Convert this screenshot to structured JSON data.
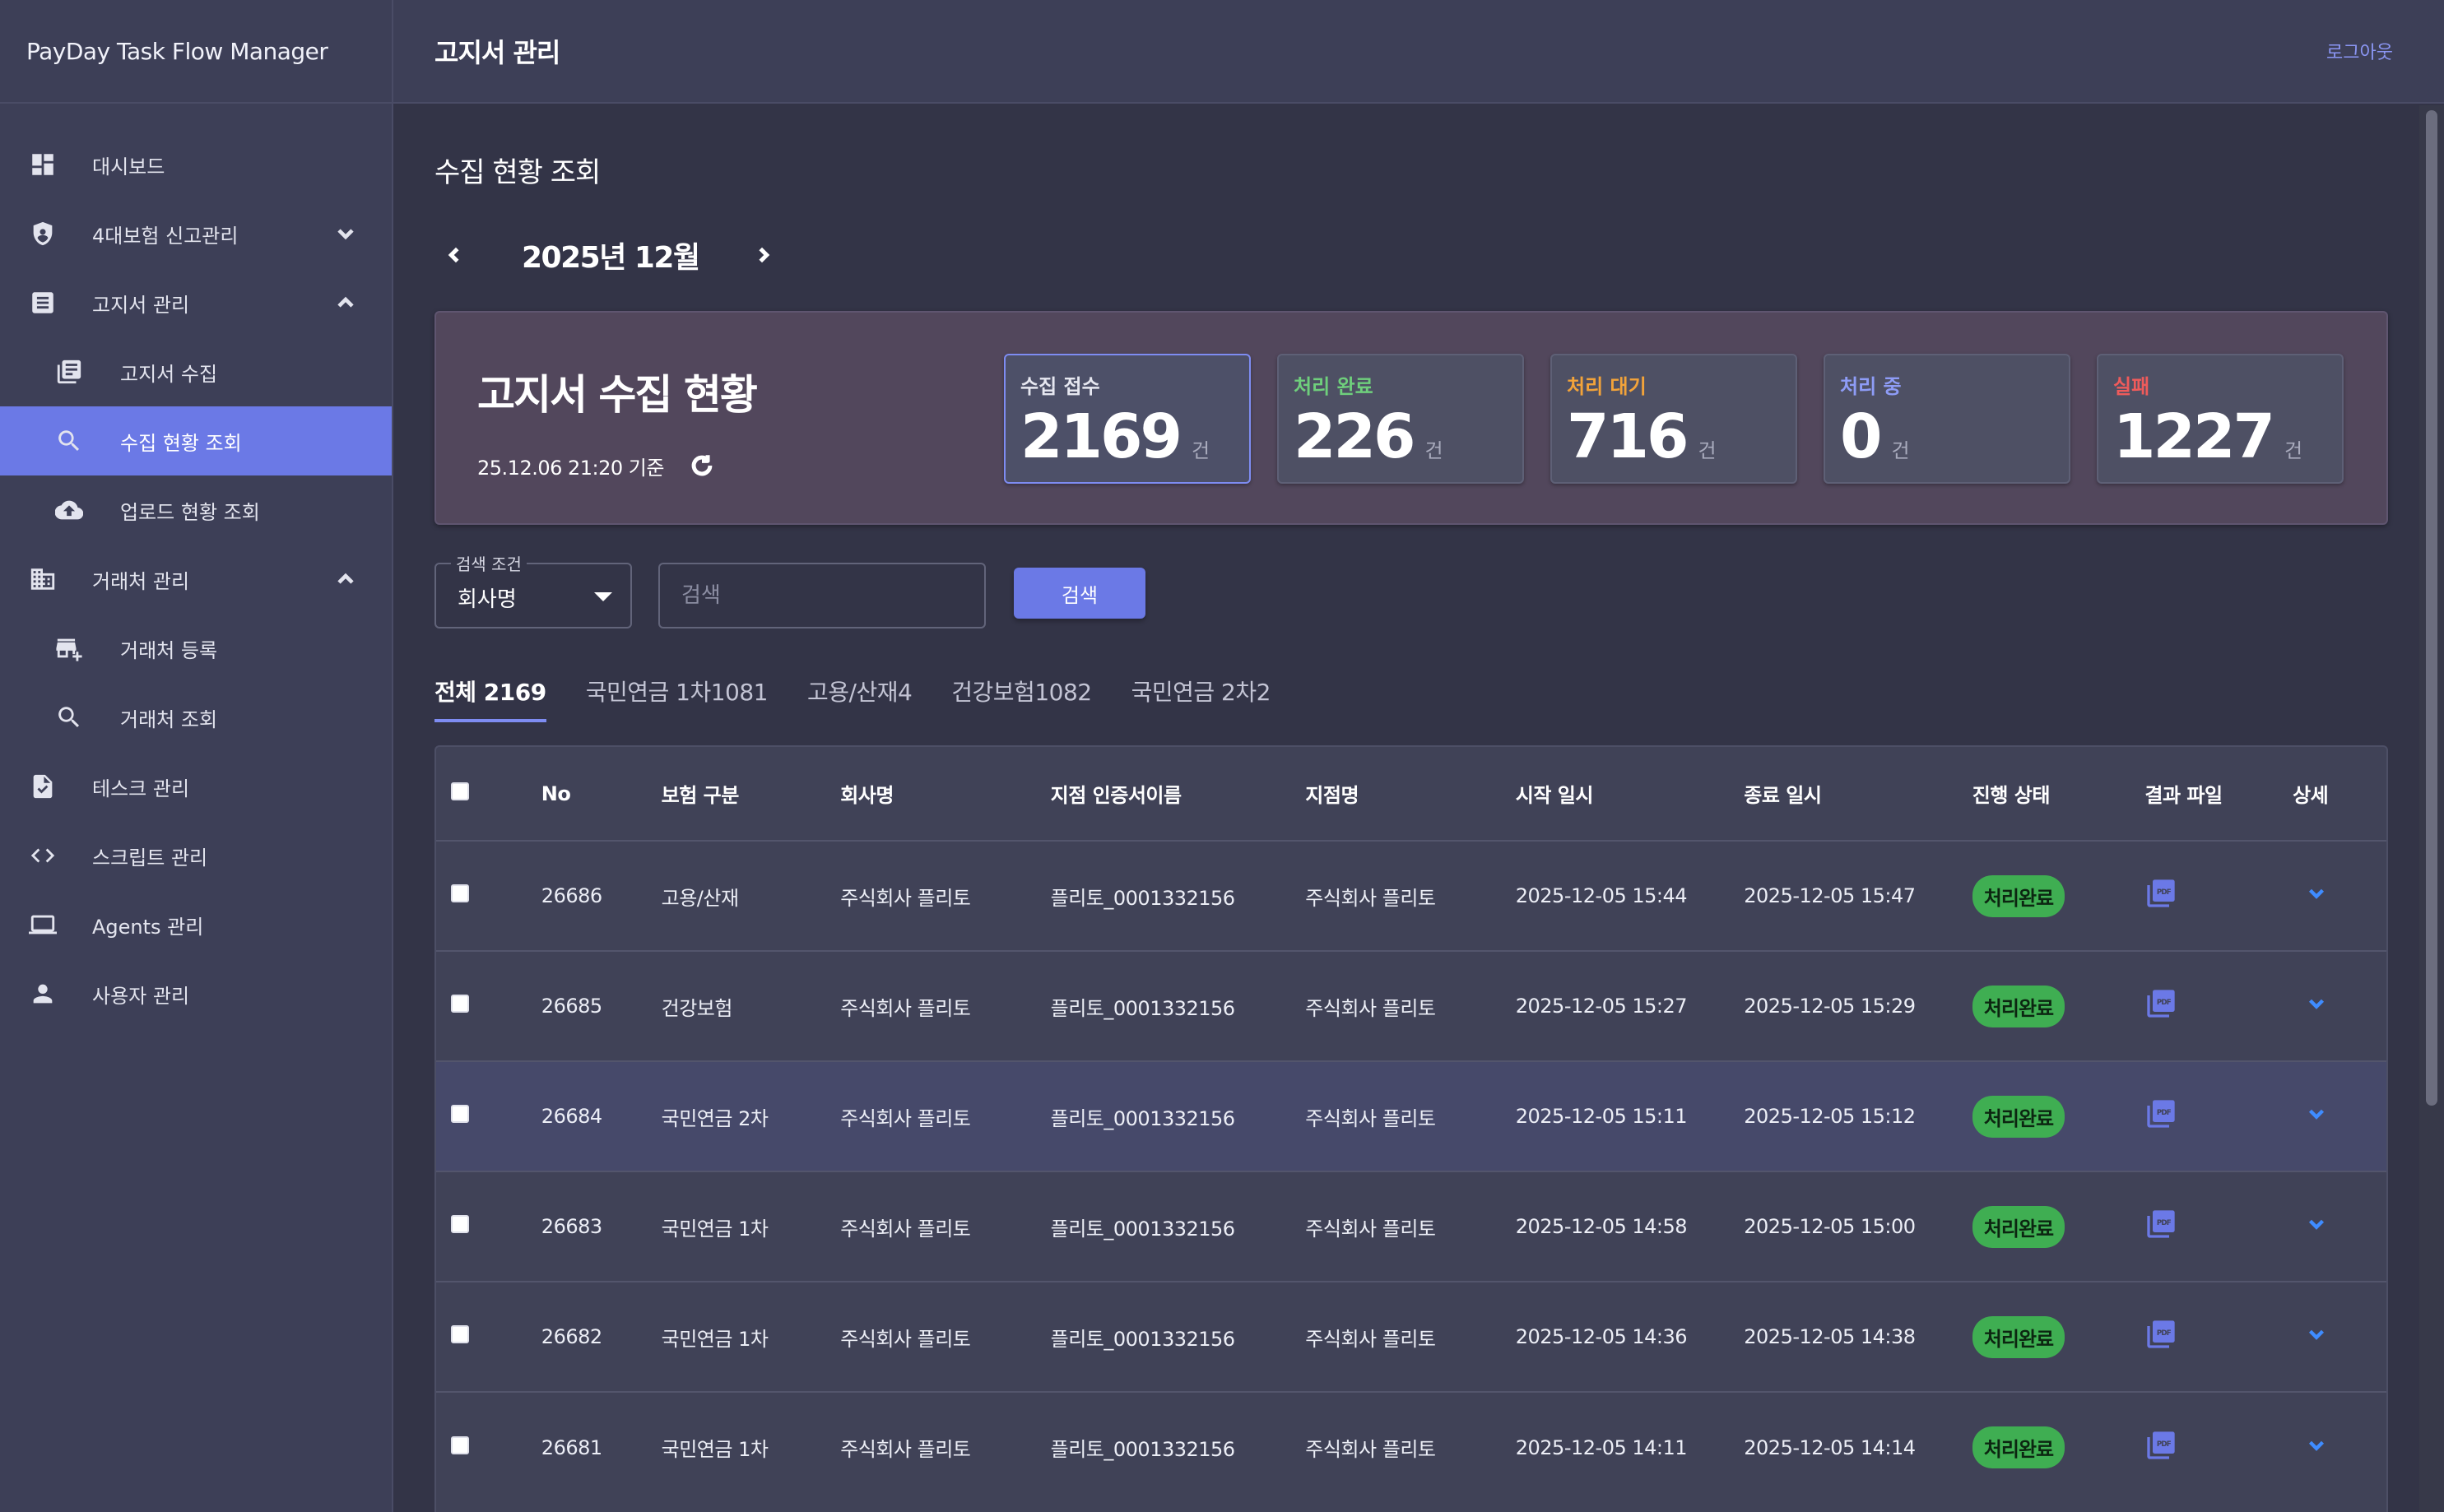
{
  "app": {
    "name": "PayDay Task Flow Manager"
  },
  "sidebar": {
    "items": [
      {
        "label": "대시보드",
        "icon": "dashboard-icon"
      },
      {
        "label": "4대보험 신고관리",
        "icon": "shield-icon",
        "expandable": "collapsed"
      },
      {
        "label": "고지서 관리",
        "icon": "document-list-icon",
        "expandable": "expanded"
      },
      {
        "label": "고지서 수집",
        "icon": "library-books-icon"
      },
      {
        "label": "수집 현황 조회",
        "icon": "search-icon",
        "active": true
      },
      {
        "label": "업로드 현황 조회",
        "icon": "cloud-upload-icon"
      },
      {
        "label": "거래처 관리",
        "icon": "building-icon",
        "expandable": "expanded"
      },
      {
        "label": "거래처 등록",
        "icon": "add-business-icon"
      },
      {
        "label": "거래처 조회",
        "icon": "search-icon"
      },
      {
        "label": "테스크 관리",
        "icon": "task-check-icon"
      },
      {
        "label": "스크립트 관리",
        "icon": "code-icon"
      },
      {
        "label": "Agents 관리",
        "icon": "laptop-icon"
      },
      {
        "label": "사용자 관리",
        "icon": "person-icon"
      }
    ]
  },
  "header": {
    "title": "고지서 관리",
    "logout": "로그아웃"
  },
  "page": {
    "title": "수집 현황 조회",
    "month": "2025년 12월"
  },
  "summary": {
    "title": "고지서 수집 현황",
    "timestamp": "25.12.06 21:20 기준",
    "unit": "건",
    "stats": [
      {
        "label": "수집 접수",
        "value": "2169",
        "color": "#e6e7f0"
      },
      {
        "label": "처리 완료",
        "value": "226",
        "color": "#6fcf7c"
      },
      {
        "label": "처리 대기",
        "value": "716",
        "color": "#f2a33a"
      },
      {
        "label": "처리 중",
        "value": "0",
        "color": "#8e9cf6"
      },
      {
        "label": "실패",
        "value": "1227",
        "color": "#ef5b5b"
      }
    ]
  },
  "search": {
    "condition_label": "검색 조건",
    "condition_value": "회사명",
    "placeholder": "검색",
    "button": "검색"
  },
  "tabs": [
    {
      "label": "전체 2169",
      "active": true
    },
    {
      "label": "국민연금 1차1081"
    },
    {
      "label": "고용/산재4"
    },
    {
      "label": "건강보험1082"
    },
    {
      "label": "국민연금 2차2"
    }
  ],
  "table": {
    "columns": [
      "No",
      "보험 구분",
      "회사명",
      "지점 인증서이름",
      "지점명",
      "시작 일시",
      "종료 일시",
      "진행 상태",
      "결과 파일",
      "상세"
    ],
    "rows": [
      {
        "no": "26686",
        "type": "고용/산재",
        "company": "주식회사 플리토",
        "cert": "플리토_0001332156",
        "branch": "주식회사 플리토",
        "start": "2025-12-05 15:44",
        "end": "2025-12-05 15:47",
        "status": "처리완료"
      },
      {
        "no": "26685",
        "type": "건강보험",
        "company": "주식회사 플리토",
        "cert": "플리토_0001332156",
        "branch": "주식회사 플리토",
        "start": "2025-12-05 15:27",
        "end": "2025-12-05 15:29",
        "status": "처리완료"
      },
      {
        "no": "26684",
        "type": "국민연금 2차",
        "company": "주식회사 플리토",
        "cert": "플리토_0001332156",
        "branch": "주식회사 플리토",
        "start": "2025-12-05 15:11",
        "end": "2025-12-05 15:12",
        "status": "처리완료",
        "highlight": true
      },
      {
        "no": "26683",
        "type": "국민연금 1차",
        "company": "주식회사 플리토",
        "cert": "플리토_0001332156",
        "branch": "주식회사 플리토",
        "start": "2025-12-05 14:58",
        "end": "2025-12-05 15:00",
        "status": "처리완료"
      },
      {
        "no": "26682",
        "type": "국민연금 1차",
        "company": "주식회사 플리토",
        "cert": "플리토_0001332156",
        "branch": "주식회사 플리토",
        "start": "2025-12-05 14:36",
        "end": "2025-12-05 14:38",
        "status": "처리완료"
      },
      {
        "no": "26681",
        "type": "국민연금 1차",
        "company": "주식회사 플리토",
        "cert": "플리토_0001332156",
        "branch": "주식회사 플리토",
        "start": "2025-12-05 14:11",
        "end": "2025-12-05 14:14",
        "status": "처리완료"
      }
    ]
  }
}
